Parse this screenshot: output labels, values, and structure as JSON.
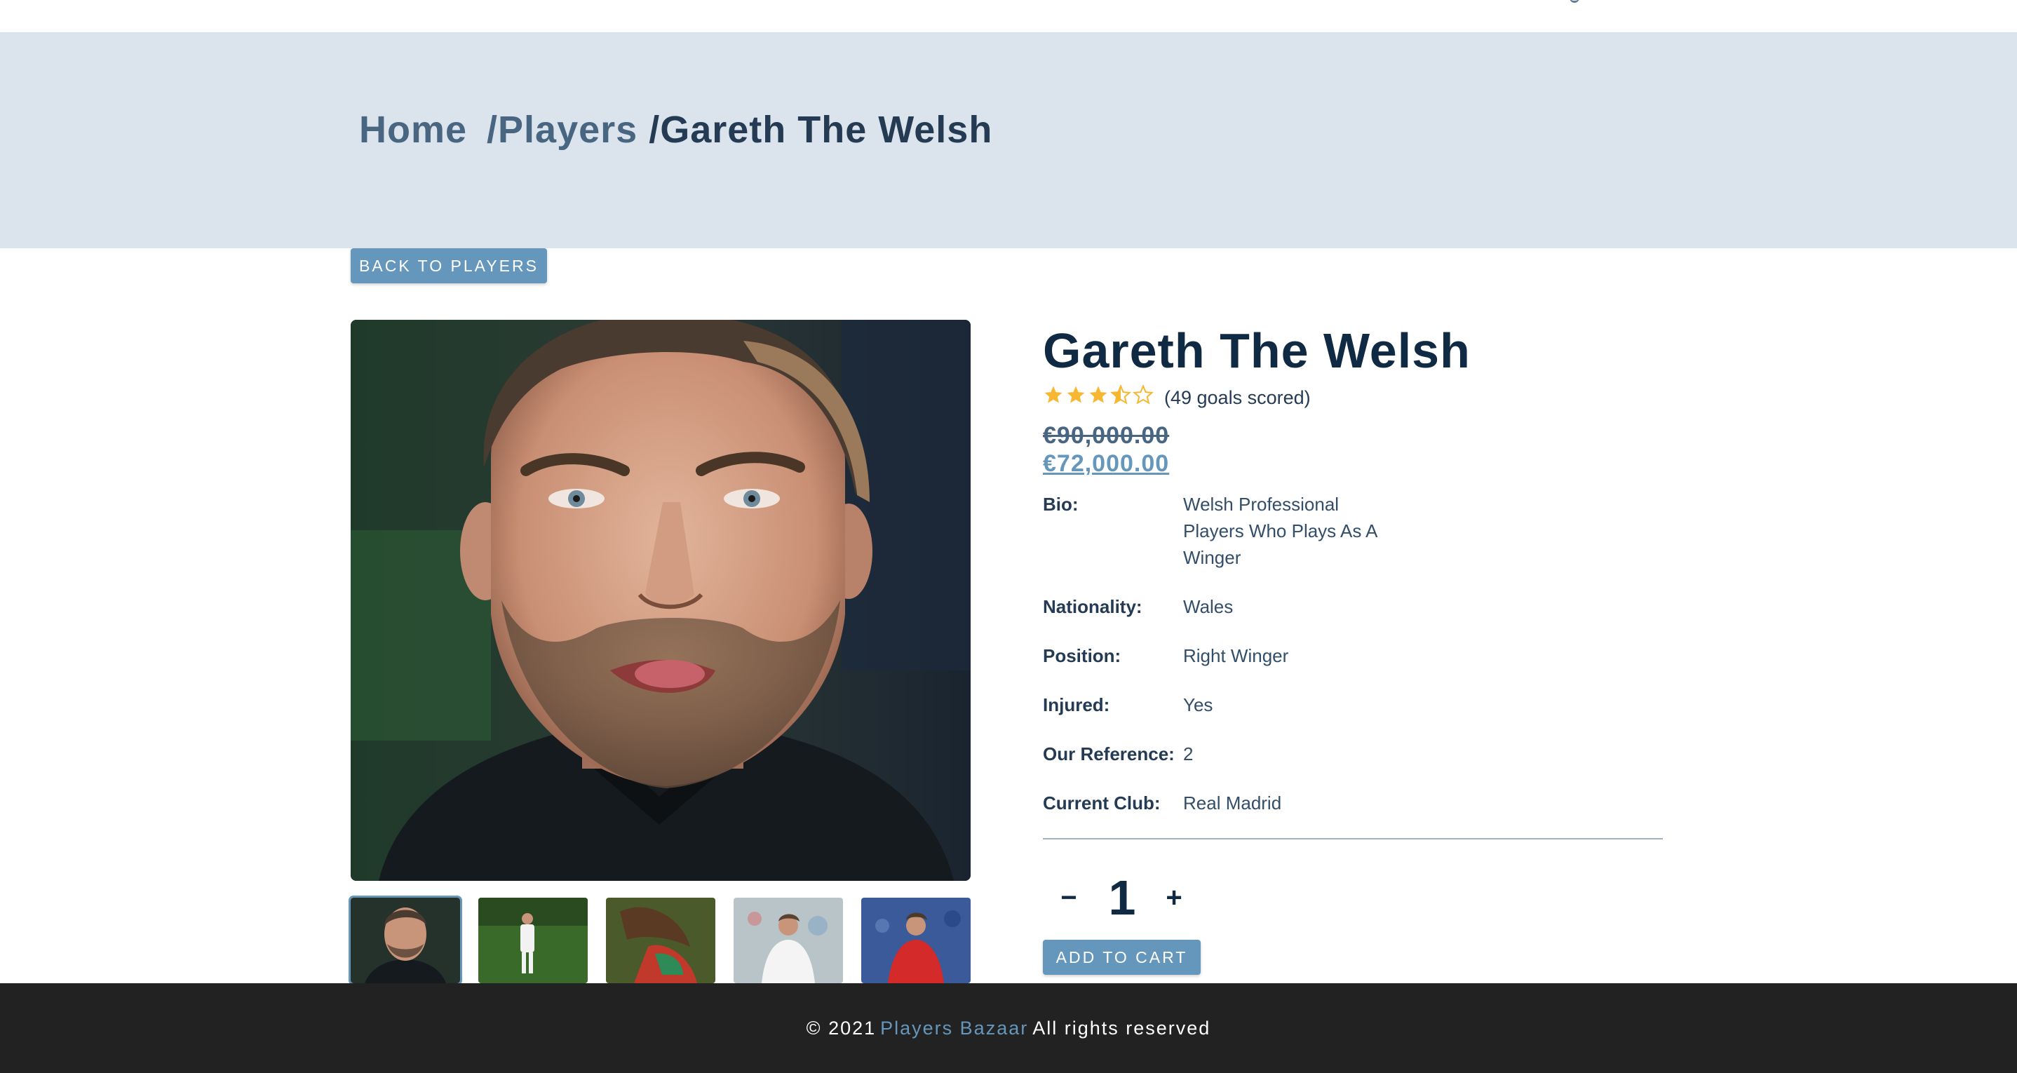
{
  "breadcrumb": {
    "home": "Home",
    "players": "/Players",
    "current": "/Gareth The Welsh"
  },
  "back_button": "BACK TO PLAYERS",
  "player": {
    "name": "Gareth The Welsh",
    "rating": 3.5,
    "rating_max": 5,
    "rating_text": "(49 goals scored)",
    "old_price": "€90,000.00",
    "new_price": "€72,000.00",
    "details": [
      {
        "label": "Bio:",
        "value": "Welsh Professional Players Who Plays As A Winger"
      },
      {
        "label": "Nationality:",
        "value": "Wales"
      },
      {
        "label": "Position:",
        "value": "Right Winger"
      },
      {
        "label": "Injured:",
        "value": "Yes"
      },
      {
        "label": "Our Reference:",
        "value": "2"
      },
      {
        "label": "Current Club:",
        "value": "Real Madrid"
      }
    ]
  },
  "quantity": {
    "minus": "−",
    "value": "1",
    "plus": "+"
  },
  "add_to_cart": "ADD TO CART",
  "footer": {
    "prefix": "© 2021",
    "brand": "Players Bazaar",
    "suffix": "All rights reserved"
  },
  "colors": {
    "accent": "#6597bc",
    "hero_bg": "#dbe4ec",
    "star": "#f7b731",
    "footer_bg": "#222222"
  }
}
